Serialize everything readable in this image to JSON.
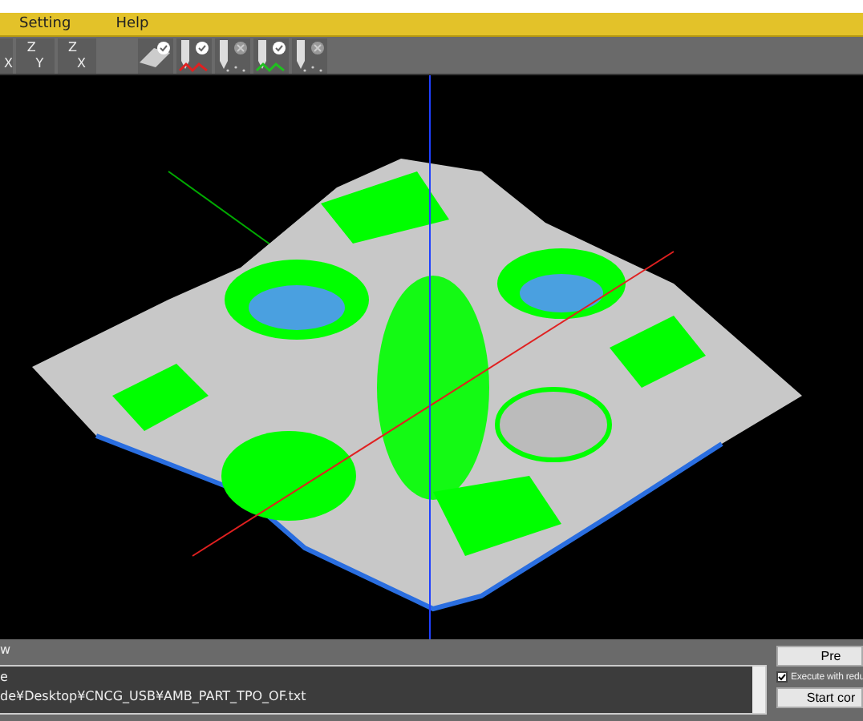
{
  "menu": [
    {
      "label": "Setting"
    },
    {
      "label": "Help"
    }
  ],
  "axis_views": [
    {
      "labels": [
        "X"
      ]
    },
    {
      "labels": [
        "Z",
        "Y"
      ]
    },
    {
      "labels": [
        "Z",
        "X"
      ]
    }
  ],
  "tools": [
    {
      "kind": "surface",
      "enabled": true
    },
    {
      "kind": "wave",
      "enabled": true,
      "color": "#e02020"
    },
    {
      "kind": "dots",
      "enabled": false
    },
    {
      "kind": "wave",
      "enabled": true,
      "color": "#20c020"
    },
    {
      "kind": "dots",
      "enabled": false
    }
  ],
  "log": {
    "label": "w",
    "lines": [
      "e",
      "de¥Desktop¥CNCG_USB¥AMB_PART_TPO_OF.txt"
    ]
  },
  "side": {
    "preview_button": "Pre",
    "reduce_option": {
      "label": "Execute with redu",
      "checked": true
    },
    "start_button": "Start cor"
  }
}
